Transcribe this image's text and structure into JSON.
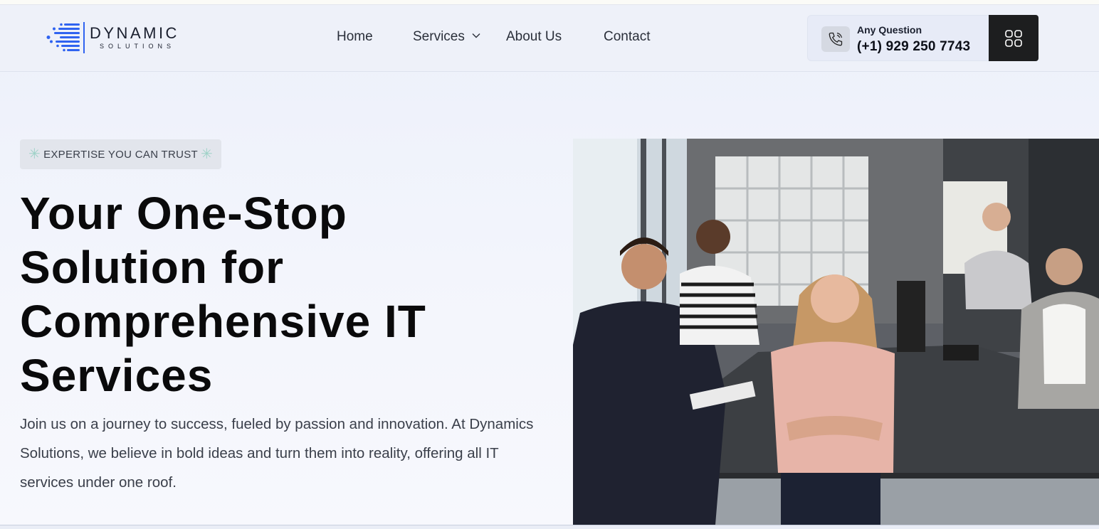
{
  "brand": {
    "name": "DYNAMIC",
    "tagline": "SOLUTIONS",
    "accent_color": "#2f63f0"
  },
  "nav": {
    "items": [
      {
        "label": "Home"
      },
      {
        "label": "Services"
      },
      {
        "label": "About Us"
      },
      {
        "label": "Contact"
      }
    ],
    "services_dropdown_icon": "chevron-down-icon"
  },
  "contact": {
    "label": "Any Question",
    "phone": "(+1) 929 250 7743",
    "icon": "phone-icon"
  },
  "menu_button": {
    "icon": "grid-menu-icon"
  },
  "hero": {
    "badge": "EXPERTISE YOU CAN TRUST",
    "badge_icon": "sparkle-icon",
    "title_lines": [
      "Your One-Stop",
      "Solution for",
      "Comprehensive IT",
      "Services"
    ],
    "description": "Join us on a journey to success, fueled by passion and innovation. At Dynamics Solutions, we believe in bold ideas and turn them into reality, offering all IT services under one roof.",
    "image": "team-photo"
  }
}
